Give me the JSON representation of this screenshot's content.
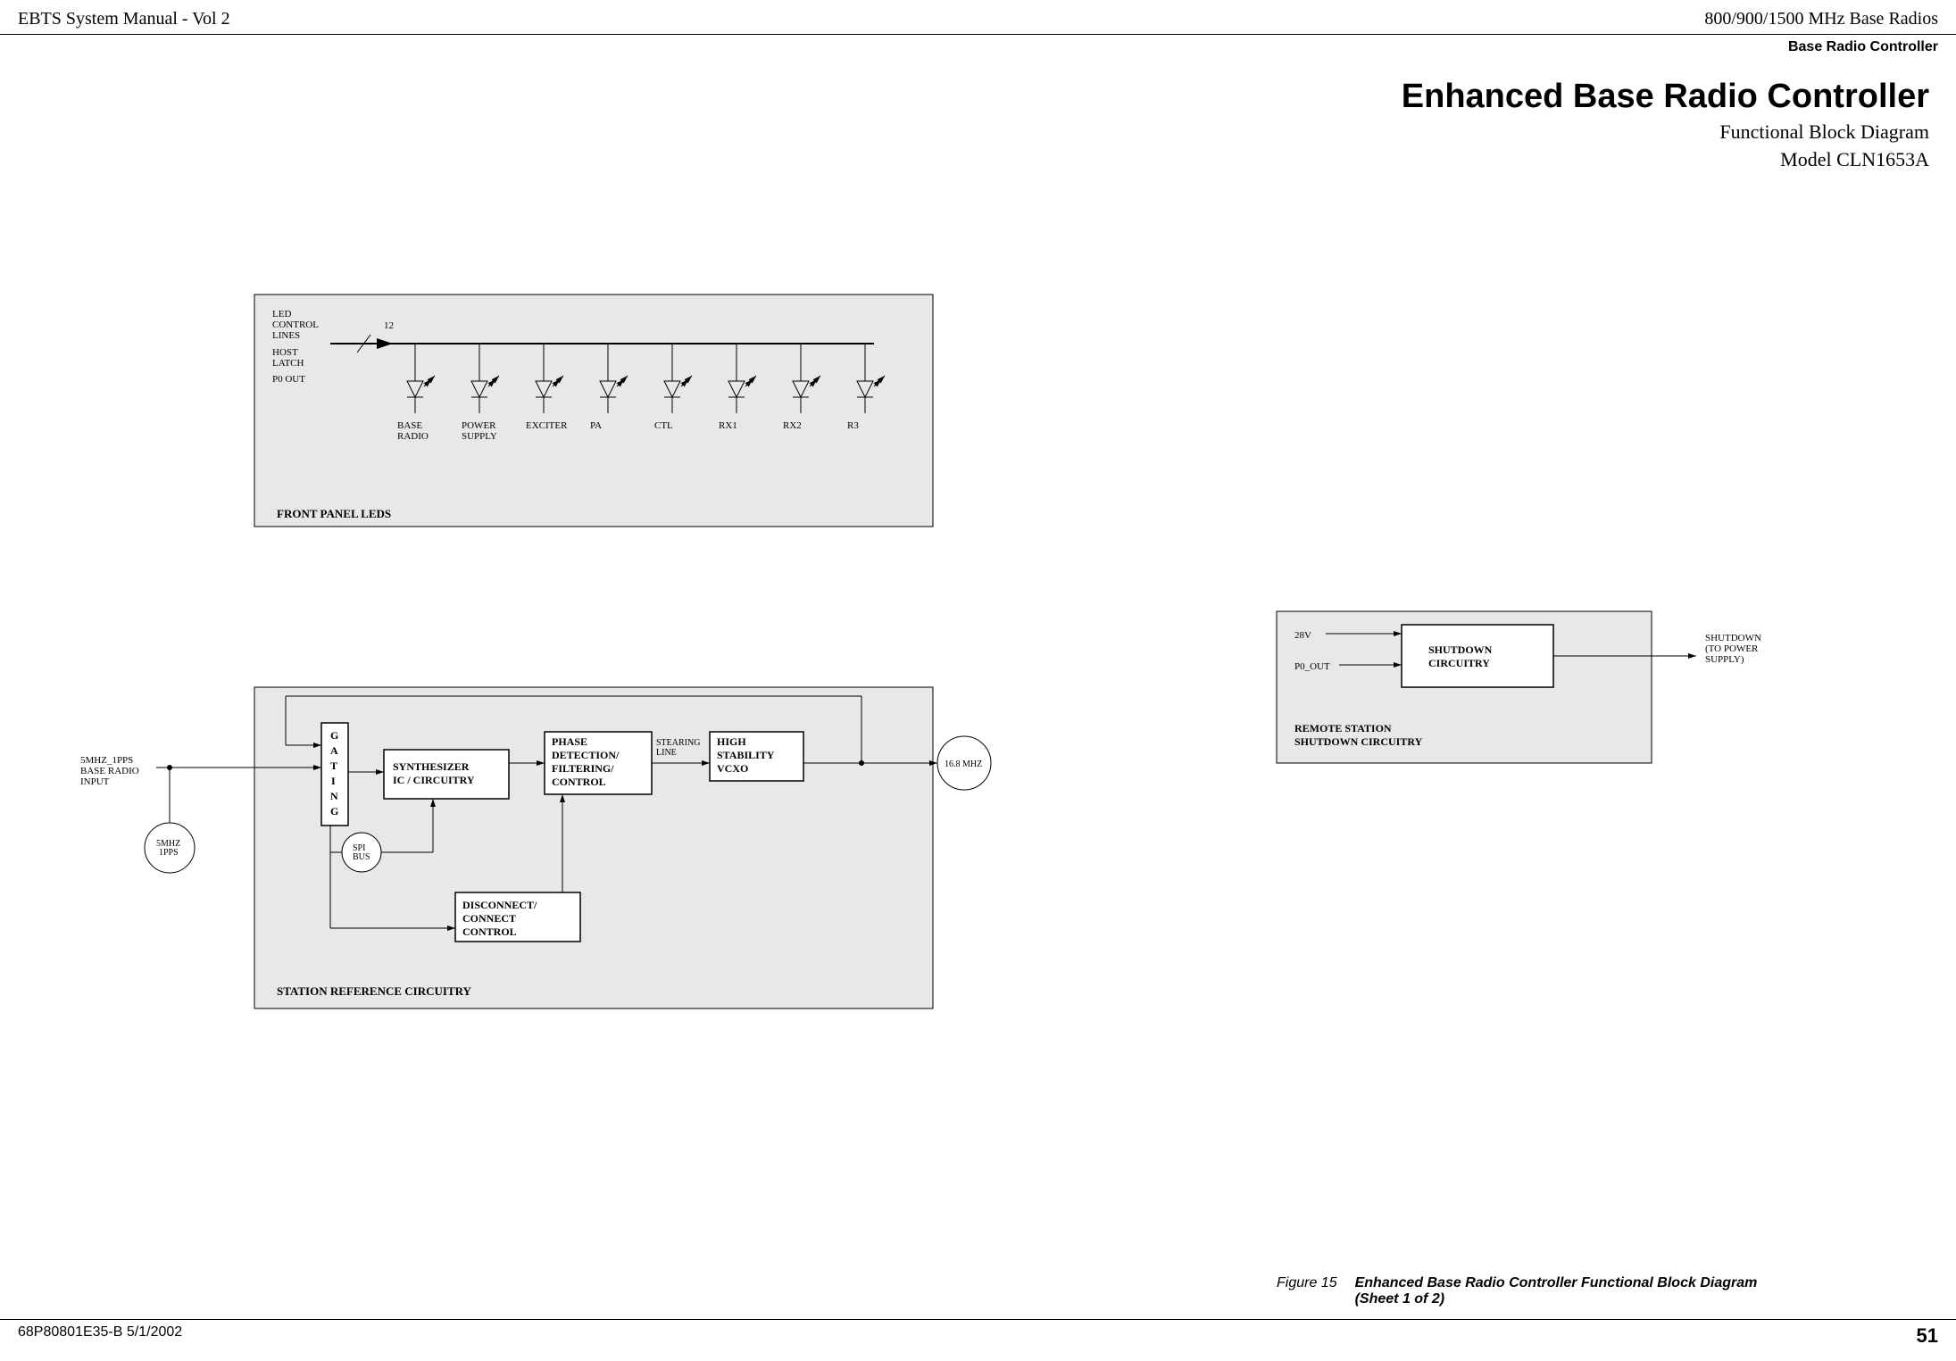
{
  "header": {
    "left": "EBTS System Manual - Vol 2",
    "right": "800/900/1500 MHz Base Radios"
  },
  "subheader": "Base Radio Controller",
  "title": {
    "main": "Enhanced Base Radio Controller",
    "sub1": "Functional Block Diagram",
    "sub2": "Model CLN1653A"
  },
  "footer": {
    "left": "68P80801E35-B   5/1/2002",
    "page": "51"
  },
  "figure": {
    "label": "Figure 15",
    "caption": "Enhanced Base Radio Controller Functional Block Diagram\n(Sheet 1 of 2)"
  },
  "diagram": {
    "front_panel": {
      "title": "FRONT PANEL LEDS",
      "labels": {
        "led_control": "LED\nCONTROL\nLINES",
        "host_latch": "HOST\nLATCH",
        "p0_out": "P0 OUT",
        "count": "12"
      },
      "leds": [
        "BASE\nRADIO",
        "POWER\nSUPPLY",
        "EXCITER",
        "PA",
        "CTL",
        "RX1",
        "RX2",
        "R3"
      ]
    },
    "station_ref": {
      "title": "STATION REFERENCE CIRCUITRY",
      "input_label": "5MHZ_1PPS\nBASE RADIO\nINPUT",
      "five_mhz": "5MHZ\n1PPS",
      "gating": "G\nA\nT\nI\nN\nG",
      "synth": "SYNTHESIZER\nIC / CIRCUITRY",
      "spi": "SPI\nBUS",
      "phase": "PHASE\nDETECTION/\nFILTERING/\nCONTROL",
      "disconnect": "DISCONNECT/\nCONNECT\nCONTROL",
      "stearing": "STEARING\nLINE",
      "vcxo": "HIGH\nSTABILITY\nVCXO",
      "output": "16.8 MHZ"
    },
    "remote": {
      "title": "REMOTE STATION\nSHUTDOWN CIRCUITRY",
      "v28": "28V",
      "p0_out": "P0_OUT",
      "shutdown": "SHUTDOWN\nCIRCUITRY",
      "shutdown_out": "SHUTDOWN\n(TO POWER\nSUPPLY)"
    }
  }
}
